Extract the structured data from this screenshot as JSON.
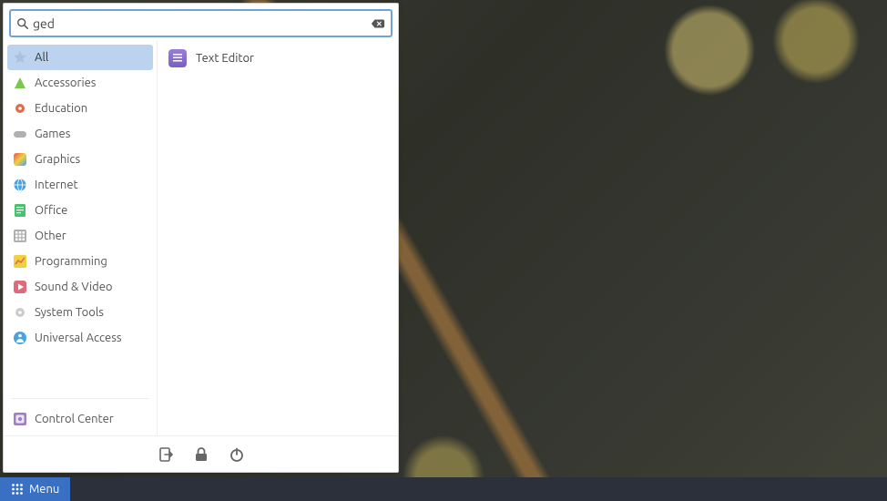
{
  "taskbar": {
    "menu_label": "Menu"
  },
  "search": {
    "query": "ged"
  },
  "categories": [
    {
      "id": "all",
      "label": "All",
      "selected": true,
      "icon": "star",
      "color": "#a8c1e0"
    },
    {
      "id": "accessories",
      "label": "Accessories",
      "icon": "triangle",
      "color": "#78c850"
    },
    {
      "id": "education",
      "label": "Education",
      "icon": "gear",
      "color": "#e06a4a"
    },
    {
      "id": "games",
      "label": "Games",
      "icon": "gamepad",
      "color": "#b0b0b0"
    },
    {
      "id": "graphics",
      "label": "Graphics",
      "icon": "palette",
      "color": "linear"
    },
    {
      "id": "internet",
      "label": "Internet",
      "icon": "globe",
      "color": "#4aa3e0"
    },
    {
      "id": "office",
      "label": "Office",
      "icon": "doc",
      "color": "#4ac070"
    },
    {
      "id": "other",
      "label": "Other",
      "icon": "grid",
      "color": "#b0b0b0"
    },
    {
      "id": "programming",
      "label": "Programming",
      "icon": "chart",
      "color": "#f0d040"
    },
    {
      "id": "sound-video",
      "label": "Sound & Video",
      "icon": "play",
      "color": "#e06a7a"
    },
    {
      "id": "system-tools",
      "label": "System Tools",
      "icon": "gear",
      "color": "#cccccc"
    },
    {
      "id": "universal-access",
      "label": "Universal Access",
      "icon": "person",
      "color": "#4aa3e0"
    }
  ],
  "control_center": {
    "label": "Control Center"
  },
  "results": [
    {
      "id": "gedit",
      "label": "Text Editor"
    }
  ],
  "bottom_buttons": {
    "logout": "logout",
    "lock": "lock",
    "power": "power"
  }
}
